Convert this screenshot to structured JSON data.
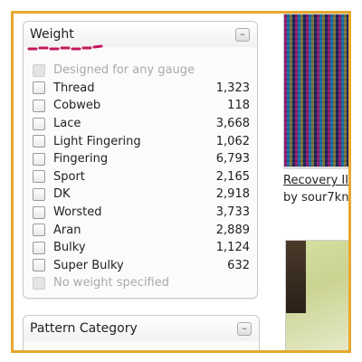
{
  "weight_panel": {
    "title": "Weight",
    "collapse_label": "–",
    "options": [
      {
        "label": "Designed for any gauge",
        "count": "",
        "disabled": true
      },
      {
        "label": "Thread",
        "count": "1,323",
        "disabled": false
      },
      {
        "label": "Cobweb",
        "count": "118",
        "disabled": false
      },
      {
        "label": "Lace",
        "count": "3,668",
        "disabled": false
      },
      {
        "label": "Light Fingering",
        "count": "1,062",
        "disabled": false
      },
      {
        "label": "Fingering",
        "count": "6,793",
        "disabled": false
      },
      {
        "label": "Sport",
        "count": "2,165",
        "disabled": false
      },
      {
        "label": "DK",
        "count": "2,918",
        "disabled": false
      },
      {
        "label": "Worsted",
        "count": "3,733",
        "disabled": false
      },
      {
        "label": "Aran",
        "count": "2,889",
        "disabled": false
      },
      {
        "label": "Bulky",
        "count": "1,124",
        "disabled": false
      },
      {
        "label": "Super Bulky",
        "count": "632",
        "disabled": false
      },
      {
        "label": "No weight specified",
        "count": "",
        "disabled": true
      }
    ]
  },
  "category_panel": {
    "title": "Pattern Category",
    "collapse_label": "–"
  },
  "result": {
    "link_title": "Recovery II",
    "byline": "by sour7kn"
  },
  "colors": {
    "frame": "#e6a92e",
    "squiggle": "#c2185b"
  }
}
